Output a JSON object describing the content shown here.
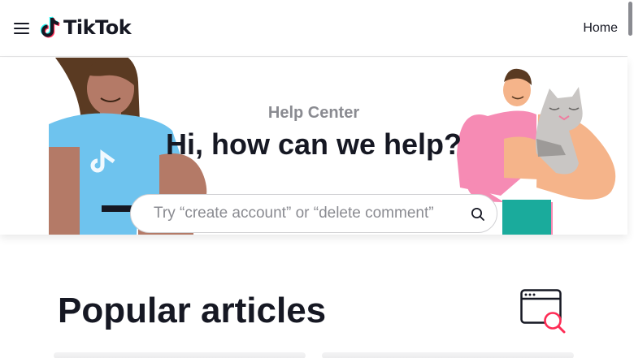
{
  "header": {
    "menu_icon": "hamburger-menu-icon",
    "logo_icon": "tiktok-note-icon",
    "logo_text": "TikTok",
    "nav_home": "Home"
  },
  "hero": {
    "subtitle": "Help Center",
    "heading": "Hi, how can we help?",
    "search_placeholder": "Try “create account” or “delete comment”",
    "search_value": "",
    "search_icon": "search-icon",
    "illustration_left": "person-in-tiktok-shirt-illustration",
    "illustration_right": "person-holding-cat-illustration"
  },
  "section": {
    "popular_title": "Popular articles",
    "popular_icon": "browser-window-search-icon"
  },
  "colors": {
    "brand_cyan": "#25f4ee",
    "brand_red": "#fe2c55",
    "text_primary": "#161823",
    "text_secondary": "#8a8b91"
  }
}
